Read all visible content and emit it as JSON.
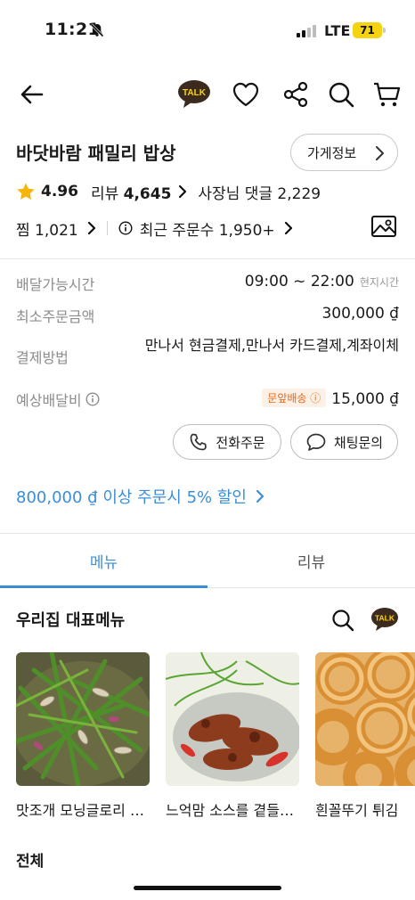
{
  "status_bar": {
    "time": "11:21",
    "network": "LTE",
    "battery": "71"
  },
  "nav": {
    "talk_badge": "TALK"
  },
  "store": {
    "name": "바닷바람 패밀리 밥상",
    "info_button": "가게정보",
    "rating": "4.96",
    "reviews_label": "리뷰",
    "reviews_count": "4,645",
    "owner_replies": "사장님 댓글 2,229",
    "likes": "찜 1,021",
    "recent_orders": "최근 주문수 1,950+"
  },
  "info": {
    "delivery_hours_label": "배달가능시간",
    "delivery_hours_value": "09:00 ~ 22:00",
    "local_time": "현지시간",
    "min_order_label": "최소주문금액",
    "min_order_value": "300,000 ₫",
    "payment_label": "결제방법",
    "payment_value": "만나서 현금결제,만나서 카드결제,계좌이체",
    "delivery_fee_label": "예상배달비",
    "door_delivery_tag": "문앞배송",
    "delivery_fee_value": "15,000 ₫"
  },
  "actions": {
    "phone_order": "전화주문",
    "chat_inquiry": "채팅문의"
  },
  "promo": {
    "text": "800,000 ₫ 이상 주문시 5% 할인"
  },
  "tabs": [
    {
      "label": "메뉴",
      "active": true
    },
    {
      "label": "리뷰",
      "active": false
    }
  ],
  "menu_section": {
    "title": "우리집 대표메뉴",
    "talk_badge": "TALK",
    "items": [
      {
        "name": "맛조개 모닝글로리 볶음",
        "image": "stir-fried-clams-morning-glory"
      },
      {
        "name": "느억맘 소스를 곁들인 오징어",
        "image": "squid-with-fish-sauce"
      },
      {
        "name": "흰꼴뚜기 튀김",
        "image": "fried-squid-rings"
      }
    ]
  },
  "all_section": {
    "title": "전체"
  },
  "colors": {
    "accent": "#3b8ed6",
    "star": "#f5b50a",
    "talk_badge": "#3d2a1f",
    "battery": "#f5d311"
  }
}
